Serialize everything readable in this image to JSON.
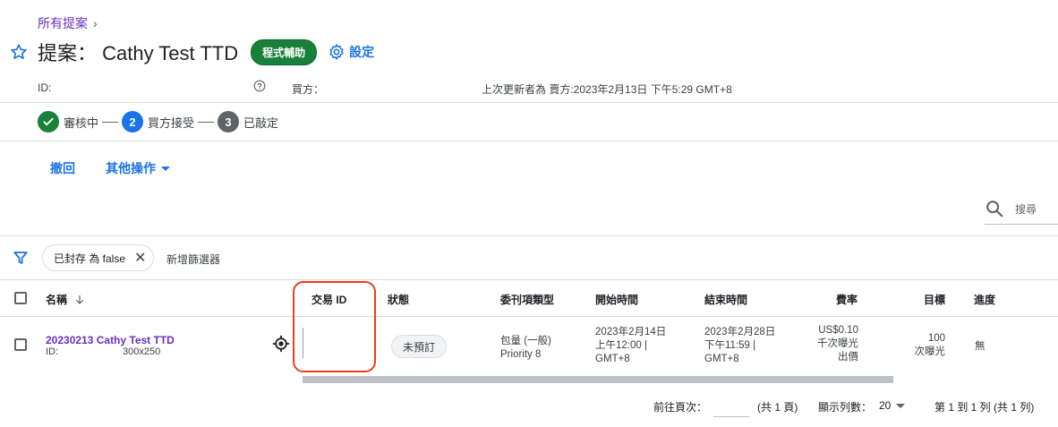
{
  "header": {
    "breadcrumb": "所有提案",
    "title": "提案： Cathy Test TTD",
    "badge": "程式輔助",
    "settings_label": "設定",
    "id_label": "ID:",
    "buyer_label": "買方：",
    "updated": "上次更新者為 賣方:2023年2月13日 下午5:29 GMT+8"
  },
  "stepper": {
    "steps": [
      {
        "label": "審核中",
        "state": "done"
      },
      {
        "num": "2",
        "label": "買方接受",
        "state": "active"
      },
      {
        "num": "3",
        "label": "已敲定",
        "state": "todo"
      }
    ]
  },
  "actions": {
    "revoke": "撤回",
    "more": "其他操作"
  },
  "search": {
    "placeholder": "搜尋"
  },
  "filters": {
    "chip": "已封存 為 false",
    "add": "新增篩選器"
  },
  "table": {
    "columns": {
      "name": "名稱",
      "deal_id": "交易 ID",
      "status": "狀態",
      "type": "委刊項類型",
      "start": "開始時間",
      "end": "結束時間",
      "rate": "費率",
      "goal": "目標",
      "progress": "進度"
    },
    "rows": [
      {
        "name": "20230213 Cathy Test TTD",
        "id_label": "ID:",
        "size": "300x250",
        "status": "未預訂",
        "type_line1": "包量 (一般)",
        "type_line2": "Priority 8",
        "start_line1": "2023年2月14日",
        "start_line2": "上午12:00 |",
        "start_line3": "GMT+8",
        "end_line1": "2023年2月28日",
        "end_line2": "下午11:59 |",
        "end_line3": "GMT+8",
        "rate_line1": "US$0.10",
        "rate_line2": "千次曝光",
        "rate_line3": "出價",
        "goal_line1": "100",
        "goal_line2": "次曝光",
        "progress": "無"
      }
    ]
  },
  "pagination": {
    "goto_label": "前往頁次：",
    "total_pages": "(共 1 頁)",
    "rows_label": "顯示列數：",
    "rows_value": "20",
    "range": "第 1 到 1 列 (共 1 列)"
  },
  "colors": {
    "accent": "#1a73e8",
    "link_purple": "#6b2fbf",
    "success": "#188038",
    "highlight": "#e53f1f"
  }
}
